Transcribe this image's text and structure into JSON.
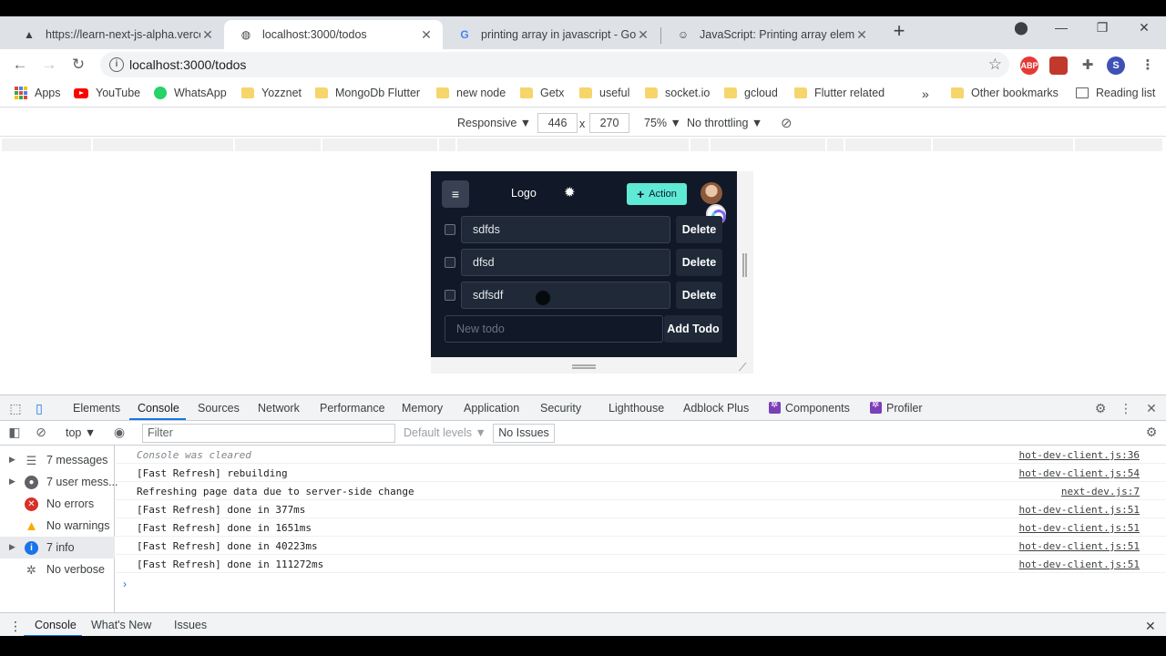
{
  "tabs": [
    {
      "title": "https://learn-next-js-alpha.vercel",
      "favicon": "vercel-triangle-icon",
      "active": false
    },
    {
      "title": "localhost:3000/todos",
      "favicon": "globe-icon",
      "active": true
    },
    {
      "title": "printing array in javascript - Goo",
      "favicon": "google-icon",
      "active": false
    },
    {
      "title": "JavaScript: Printing array element",
      "favicon": "person-avatar-icon",
      "active": false
    }
  ],
  "address_bar": {
    "url": "localhost:3000/todos"
  },
  "extensions": [
    {
      "label": "ABP",
      "color": "#e53935"
    },
    {
      "label": "",
      "color": "#c0392b"
    },
    {
      "label": "S",
      "color": "#3f51b5"
    }
  ],
  "bookmarks": [
    {
      "label": "Apps"
    },
    {
      "label": "YouTube"
    },
    {
      "label": "WhatsApp"
    },
    {
      "label": "Yozznet"
    },
    {
      "label": "MongoDb Flutter"
    },
    {
      "label": "new node"
    },
    {
      "label": "Getx"
    },
    {
      "label": "useful"
    },
    {
      "label": "socket.io"
    },
    {
      "label": "gcloud"
    },
    {
      "label": "Flutter related"
    },
    {
      "label": "Other bookmarks"
    },
    {
      "label": "Reading list"
    }
  ],
  "overflow_chevron": "»",
  "device_toolbar": {
    "mode": "Responsive ▼",
    "width": "446",
    "times": "x",
    "height": "270",
    "zoom": "75% ▼",
    "throttling": "No throttling ▼"
  },
  "app": {
    "logo": "Logo",
    "action_label": "Action",
    "todos": [
      {
        "text": "sdfds",
        "delete_label": "Delete"
      },
      {
        "text": "dfsd",
        "delete_label": "Delete"
      },
      {
        "text": "sdfsdf",
        "delete_label": "Delete"
      }
    ],
    "new_todo_placeholder": "New todo",
    "add_label": "Add Todo"
  },
  "devtools": {
    "tabs": [
      "Elements",
      "Console",
      "Sources",
      "Network",
      "Performance",
      "Memory",
      "Application",
      "Security",
      "Lighthouse",
      "Adblock Plus",
      "Components",
      "Profiler"
    ],
    "active_tab": "Console",
    "context": "top ▼",
    "filter_placeholder": "Filter",
    "levels": "Default levels ▼",
    "issues": "No Issues",
    "sidebar": [
      {
        "label": "7 messages",
        "icon": "list-icon",
        "expandable": true
      },
      {
        "label": "7 user mess...",
        "icon": "user-icon",
        "expandable": true
      },
      {
        "label": "No errors",
        "icon": "error-icon",
        "expandable": false
      },
      {
        "label": "No warnings",
        "icon": "warning-icon",
        "expandable": false
      },
      {
        "label": "7 info",
        "icon": "info-icon",
        "expandable": true,
        "selected": true
      },
      {
        "label": "No verbose",
        "icon": "bug-icon",
        "expandable": false
      }
    ],
    "logs": [
      {
        "message": "Console was cleared",
        "source": "hot-dev-client.js:36",
        "italic": true
      },
      {
        "message": "[Fast Refresh] rebuilding",
        "source": "hot-dev-client.js:54"
      },
      {
        "message": "Refreshing page data due to server-side change",
        "source": "next-dev.js:7"
      },
      {
        "message": "[Fast Refresh] done in 377ms",
        "source": "hot-dev-client.js:51"
      },
      {
        "message": "[Fast Refresh] done in 1651ms",
        "source": "hot-dev-client.js:51"
      },
      {
        "message": "[Fast Refresh] done in 40223ms",
        "source": "hot-dev-client.js:51"
      },
      {
        "message": "[Fast Refresh] done in 111272ms",
        "source": "hot-dev-client.js:51"
      }
    ],
    "drawer_tabs": [
      "Console",
      "What's New",
      "Issues"
    ]
  }
}
